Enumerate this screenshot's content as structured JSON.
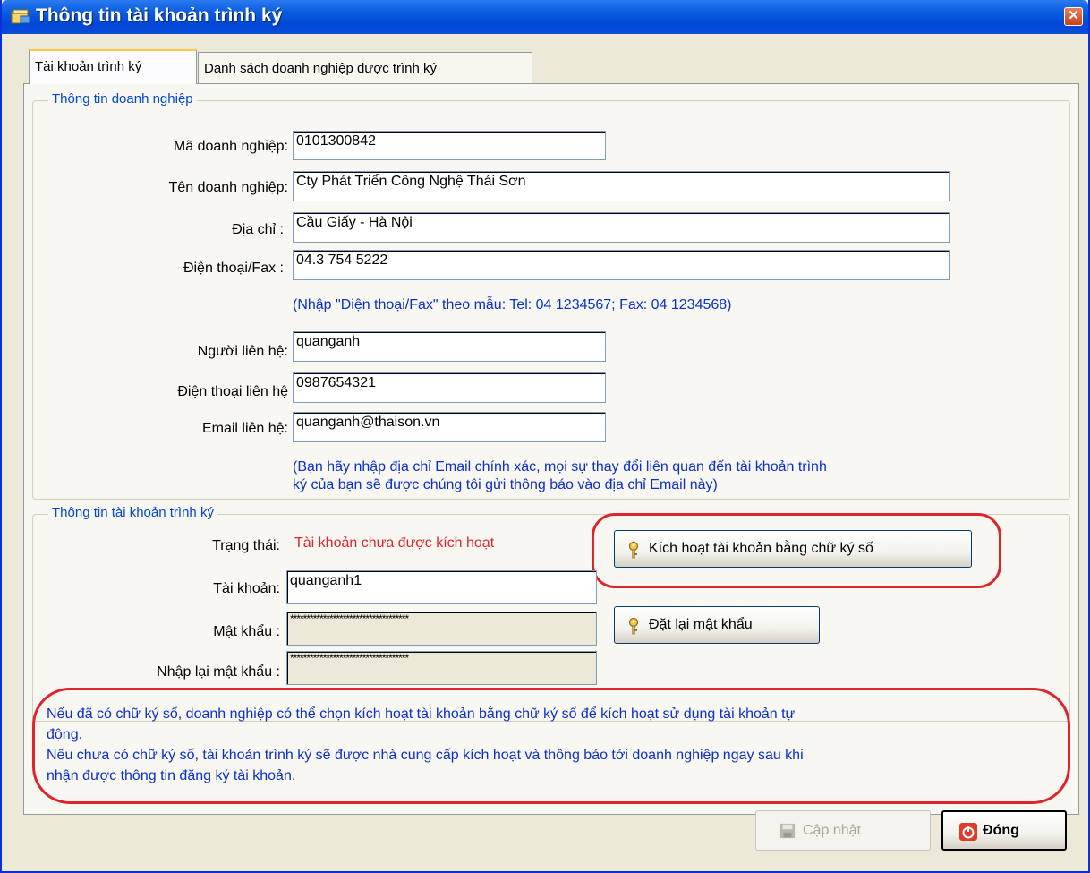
{
  "window": {
    "title": "Thông tin tài khoản trình ký",
    "close_glyph": "✕"
  },
  "tabs": [
    {
      "label": "Tài khoản trình ký",
      "active": true
    },
    {
      "label": "Danh sách doanh nghiệp được trình ký",
      "active": false
    }
  ],
  "company": {
    "legend": "Thông tin doanh nghiệp",
    "code_label": "Mã doanh nghiệp:",
    "code_value": "0101300842",
    "name_label": "Tên doanh nghiệp:",
    "name_value": "Cty Phát Triển Công Nghệ Thái Sơn",
    "address_label": "Địa chỉ :",
    "address_value": "Cầu Giấy -  Hà Nội",
    "phone_label": "Điện thoại/Fax :",
    "phone_value": "04.3 754 5222",
    "phone_hint": "(Nhập \"Điện thoại/Fax\" theo mẫu: Tel: 04 1234567; Fax: 04 1234568)",
    "contact_label": "Người liên hệ:",
    "contact_value": "quanganh",
    "contact_phone_label": "Điện thoại liên hệ",
    "contact_phone_value": "0987654321",
    "email_label": "Email liên hệ:",
    "email_value": "quanganh@thaison.vn",
    "email_hint_line1": "(Bạn hãy nhập địa chỉ Email chính xác, mọi sự thay đổi liên quan đến tài khoản trình",
    "email_hint_line2": "ký của bạn sẽ được chúng tôi gửi thông báo vào địa chỉ Email này)"
  },
  "account": {
    "legend": "Thông tin tài khoản trình ký",
    "status_label": "Trạng thái:",
    "status_value": "Tài khoản chưa được kích hoạt",
    "activate_button": "Kích hoạt tài khoản bằng chữ ký số",
    "username_label": "Tài khoản:",
    "username_value": "quanganh1",
    "password_label": "Mật khẩu :",
    "password_value": "************************************",
    "reset_button": "Đặt lại mật khẩu",
    "confirm_label": "Nhập lại mật khẩu :",
    "confirm_value": "************************************"
  },
  "notice": {
    "line1": "Nếu đã có chữ ký số, doanh nghiệp có thể chọn kích hoạt tài khoản bằng chữ ký số để kích hoạt sử dụng tài khoản tự",
    "line2": "động.",
    "line3": "Nếu chưa có chữ ký số, tài khoản trình ký sẽ được nhà cung cấp kích hoạt và thông báo tới doanh nghiệp ngay sau khi",
    "line4": "nhận được thông tin đăng ký tài khoản."
  },
  "footer": {
    "update_button": "Cập nhật",
    "close_button": "Đóng"
  },
  "colors": {
    "hint_blue": "#0b2fd0",
    "status_red": "#e0242c",
    "highlight_oval": "#e0242c",
    "titlebar": "#0a5ee0"
  },
  "icons": [
    "window-icon",
    "close-icon",
    "key-icon",
    "save-icon",
    "power-icon"
  ]
}
